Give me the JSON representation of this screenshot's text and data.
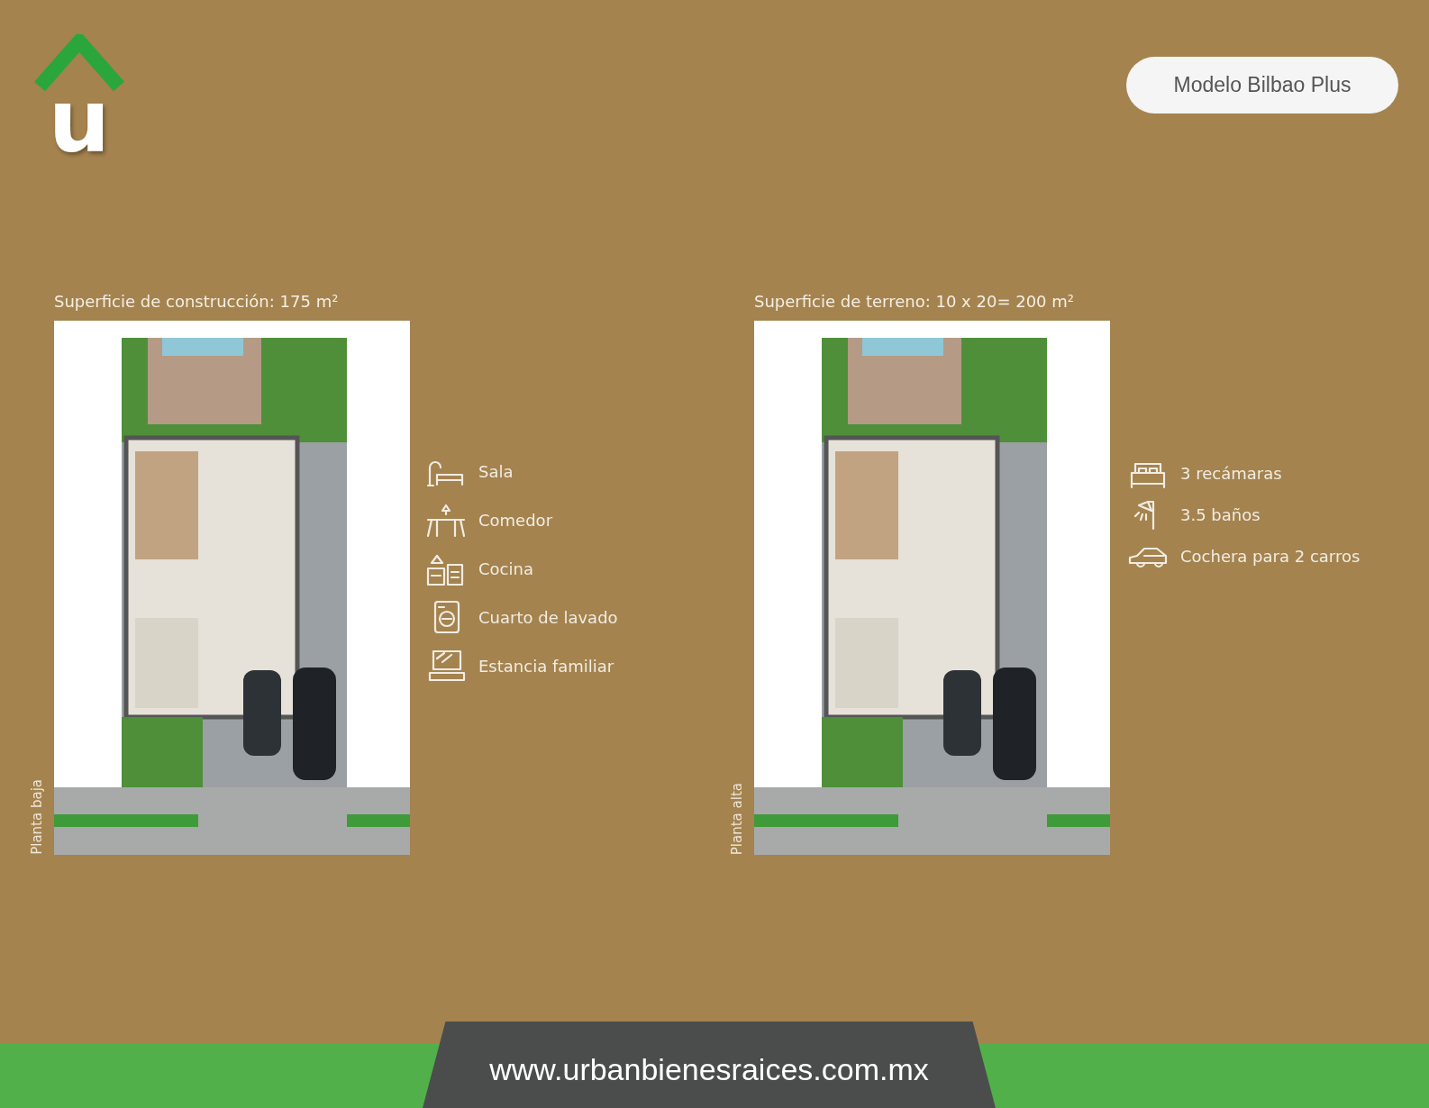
{
  "logo": {
    "letter": "u"
  },
  "model_button": "Modelo Bilbao Plus",
  "panels": [
    {
      "title": "Superficie de construcción: 175 m²",
      "floor_label": "Planta baja",
      "features": [
        {
          "label": "Sala"
        },
        {
          "label": "Comedor"
        },
        {
          "label": "Cocina"
        },
        {
          "label": "Cuarto de lavado"
        },
        {
          "label": "Estancia familiar"
        }
      ]
    },
    {
      "title": "Superficie de terreno: 10 x 20= 200 m²",
      "floor_label": "Planta alta",
      "features": [
        {
          "label": "3 recámaras"
        },
        {
          "label": "3.5 baños"
        },
        {
          "label": "Cochera para 2 carros"
        }
      ]
    }
  ],
  "footer": {
    "website": "www.urbanbienesraices.com.mx"
  }
}
